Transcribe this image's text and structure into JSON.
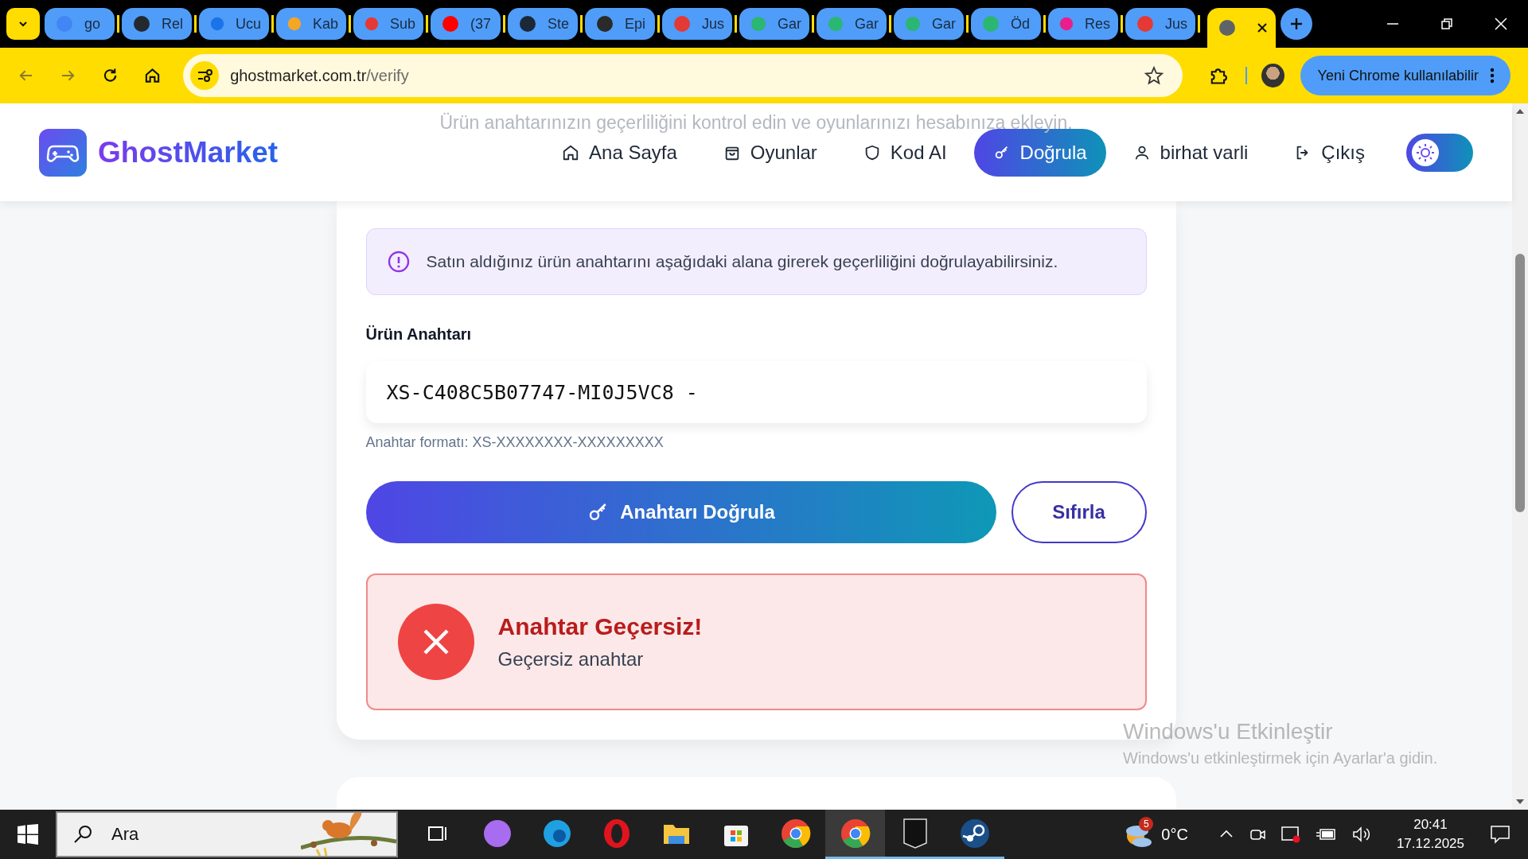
{
  "browser": {
    "tabs": [
      {
        "label": "go",
        "color": "#4285f4",
        "selected": false
      },
      {
        "label": "Rel",
        "color": "#24292f",
        "selected": false
      },
      {
        "label": "Ucu",
        "color": "#1a73e8",
        "selected": false
      },
      {
        "label": "Kab",
        "color": "#f5a623",
        "selected": false
      },
      {
        "label": "Sub",
        "color": "#e53935",
        "selected": false
      },
      {
        "label": "(37",
        "color": "#ff0000",
        "selected": false
      },
      {
        "label": "Ste",
        "color": "#1b2838",
        "selected": false
      },
      {
        "label": "Epi",
        "color": "#2a2a2a",
        "selected": false
      },
      {
        "label": "Jus",
        "color": "#e53935",
        "selected": false
      },
      {
        "label": "Gar",
        "color": "#2bb673",
        "selected": false
      },
      {
        "label": "Gar",
        "color": "#2bb673",
        "selected": false
      },
      {
        "label": "Gar",
        "color": "#2bb673",
        "selected": false
      },
      {
        "label": "Öd",
        "color": "#2bb673",
        "selected": false
      },
      {
        "label": "Res",
        "color": "#e91e8c",
        "selected": false
      },
      {
        "label": "Jus",
        "color": "#e53935",
        "selected": false
      },
      {
        "color": "#5f6368",
        "selected": true
      }
    ],
    "address": {
      "host": "ghostmarket.com.tr",
      "path": "/verify"
    },
    "update_button": "Yeni Chrome kullanılabilir"
  },
  "header": {
    "logo": "GhostMarket",
    "faded_subtitle": "Ürün anahtarınızın geçerliliğini kontrol edin ve oyunlarınızı hesabınıza ekleyin.",
    "nav": [
      {
        "label": "Ana Sayfa",
        "kind": "home",
        "selected": false
      },
      {
        "label": "Oyunlar",
        "kind": "bag",
        "selected": false
      },
      {
        "label": "Kod AI",
        "kind": "shield",
        "selected": false
      },
      {
        "label": "Doğrula",
        "kind": "key",
        "selected": true
      },
      {
        "label": "birhat varli",
        "kind": "user",
        "selected": false
      },
      {
        "label": "Çıkış",
        "kind": "logout",
        "selected": false
      }
    ],
    "theme_toggle": {
      "on": false
    }
  },
  "notice": "Satın aldığınız ürün anahtarını aşağıdaki alana girerek geçerliliğini doğrulayabilirsiniz.",
  "key_field": {
    "label": "Ürün Anahtarı",
    "value": "XS-C408C5B07747-MI0J5VC8 -",
    "hint": "Anahtar formatı: XS-XXXXXXXX-XXXXXXXXX"
  },
  "buttons": [
    {
      "label": "Anahtarı Doğrula",
      "kind": "primary"
    },
    {
      "label": "Sıfırla",
      "kind": "secondary"
    }
  ],
  "result": {
    "title": "Anahtar Geçersiz!",
    "message": "Geçersiz anahtar"
  },
  "activation": {
    "title": "Windows'u Etkinleştir",
    "message": "Windows'u etkinleştirmek için Ayarlar'a gidin."
  },
  "taskbar": {
    "search_placeholder": "Ara",
    "apps": [
      {
        "kind": "taskview",
        "selected": false,
        "running": false
      },
      {
        "kind": "copilot",
        "selected": false,
        "running": false
      },
      {
        "kind": "edge",
        "selected": false,
        "running": false
      },
      {
        "kind": "opera",
        "selected": false,
        "running": false
      },
      {
        "kind": "folder",
        "selected": false,
        "running": false
      },
      {
        "kind": "store",
        "selected": false,
        "running": false
      },
      {
        "kind": "chrome",
        "selected": false,
        "running": false
      },
      {
        "kind": "chrome",
        "selected": true,
        "running": true
      },
      {
        "kind": "epic",
        "selected": false,
        "running": true
      },
      {
        "kind": "steam",
        "selected": false,
        "running": true
      }
    ],
    "weather": {
      "badge": "5",
      "temp": "0°C"
    },
    "time": "20:41",
    "date": "17.12.2025"
  }
}
